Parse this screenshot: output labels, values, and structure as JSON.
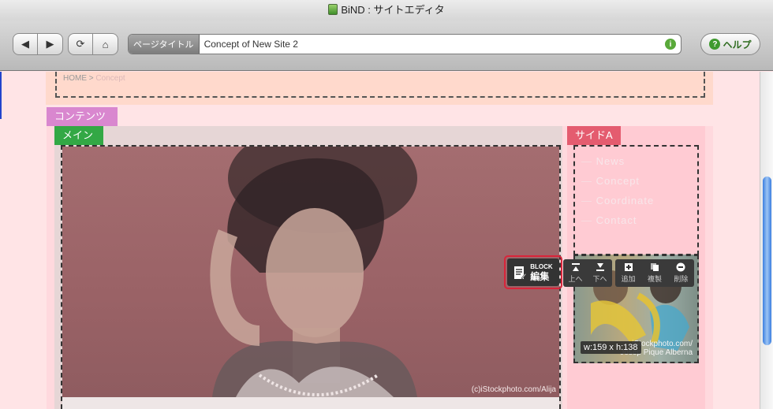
{
  "window": {
    "title": "BiND : サイトエディタ"
  },
  "toolbar": {
    "back_icon": "◀",
    "forward_icon": "▶",
    "reload_icon": "⟳",
    "home_icon": "⌂",
    "page_title_label": "ページタイトル",
    "page_title_value": "Concept of New Site 2",
    "info_icon": "i",
    "help_icon": "?",
    "help_label": "ヘルプ"
  },
  "breadcrumb": {
    "home": "HOME",
    "separator": " > ",
    "current": "Concept"
  },
  "areas": {
    "contents": "コンテンツ",
    "main": "メイン",
    "side": "サイドA"
  },
  "main_photo": {
    "caption": "(c)iStockphoto.com/Alija"
  },
  "side_nav": {
    "items": [
      "News",
      "Concept",
      "Coordinate",
      "Contact"
    ]
  },
  "side_photo": {
    "caption_line1": "iStockphoto.com/",
    "caption_line2": "Josep Pique Alberna",
    "size_label": "w:159 x h:138"
  },
  "block_toolbar": {
    "edit_top": "BLOCK",
    "edit_bottom": "編集",
    "up_label": "上へ",
    "down_label": "下へ",
    "add_label": "追加",
    "duplicate_label": "複製",
    "delete_label": "削除"
  },
  "colors": {
    "contents_tag": "#d987cf",
    "main_tag": "#33a845",
    "side_tag": "#e45c6f",
    "canvas_bg": "#ffe4e6",
    "highlight_border": "#d9243a"
  }
}
